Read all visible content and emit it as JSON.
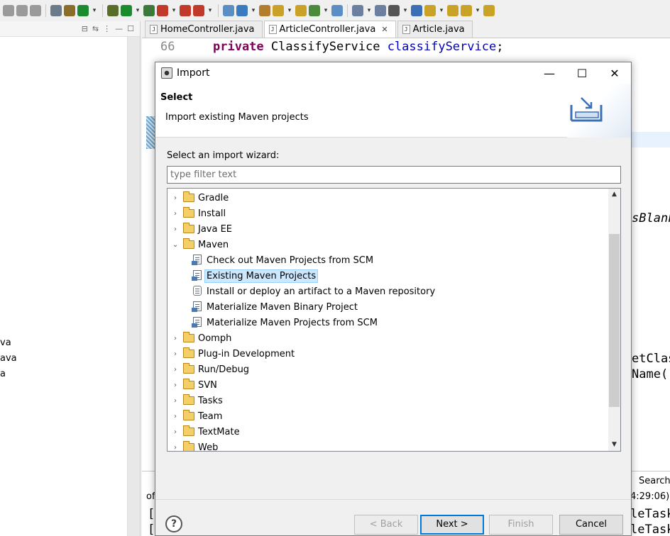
{
  "toolbar": {
    "icon_colors": [
      "#9a9a9a",
      "#9a9a9a",
      "#9a9a9a",
      "#6b7b8c",
      "#8a6d2a",
      "#1c8a2e",
      "#5a6e2a",
      "#1c8a2e",
      "#3c7a3c",
      "#c0392b",
      "#c0392b",
      "#c0392b",
      "#5b8fc4",
      "#3a7bbf",
      "#b27d2c",
      "#c9a227",
      "#c9a227",
      "#4a8a3a",
      "#5b8fc4",
      "#6d7fa0",
      "#6d7fa0",
      "#555555",
      "#3b6fb6",
      "#c9a227",
      "#c9a227",
      "#c9a227",
      "#c9a227"
    ]
  },
  "left_view": {
    "files": [
      "va",
      "ava",
      "a"
    ]
  },
  "editor": {
    "tabs": [
      {
        "label": "HomeController.java",
        "active": false
      },
      {
        "label": "ArticleController.java",
        "active": true,
        "close": "✕"
      },
      {
        "label": "Article.java",
        "active": false
      }
    ],
    "line_number": "66",
    "code_keyword": "private",
    "code_type": "ClassifyService",
    "code_field": "classifyService",
    "code_end": ";",
    "fragments": {
      "blank": "sBlank",
      "getclass": "etClas",
      "name": "Name()"
    }
  },
  "bottom_panel": {
    "tab_prefix": "of",
    "search_label": "Search",
    "time": "4:29:06)",
    "line1_prefix": "[",
    "line1_suffix": "leTask",
    "line2_prefix": "[",
    "line2_suffix": "leTask"
  },
  "dialog": {
    "title": "Import",
    "minimize": "—",
    "maximize": "☐",
    "close": "✕",
    "header_title": "Select",
    "header_desc": "Import existing Maven projects",
    "wizard_label": "Select an import wizard:",
    "filter_placeholder": "type filter text",
    "tree": [
      {
        "label": "Gradle",
        "expanded": false
      },
      {
        "label": "Install",
        "expanded": false
      },
      {
        "label": "Java EE",
        "expanded": false
      },
      {
        "label": "Maven",
        "expanded": true
      },
      {
        "label": "Check out Maven Projects from SCM",
        "child": true
      },
      {
        "label": "Existing Maven Projects",
        "child": true,
        "selected": true
      },
      {
        "label": "Install or deploy an artifact to a Maven repository",
        "child": true,
        "plain": true
      },
      {
        "label": "Materialize Maven Binary Project",
        "child": true
      },
      {
        "label": "Materialize Maven Projects from SCM",
        "child": true
      },
      {
        "label": "Oomph",
        "expanded": false
      },
      {
        "label": "Plug-in Development",
        "expanded": false
      },
      {
        "label": "Run/Debug",
        "expanded": false
      },
      {
        "label": "SVN",
        "expanded": false
      },
      {
        "label": "Tasks",
        "expanded": false
      },
      {
        "label": "Team",
        "expanded": false
      },
      {
        "label": "TextMate",
        "expanded": false
      },
      {
        "label": "Web",
        "expanded": false
      }
    ],
    "scroll_up": "▲",
    "scroll_down": "▼",
    "help_label": "?",
    "buttons": {
      "back": "< Back",
      "next": "Next >",
      "finish": "Finish",
      "cancel": "Cancel"
    }
  }
}
